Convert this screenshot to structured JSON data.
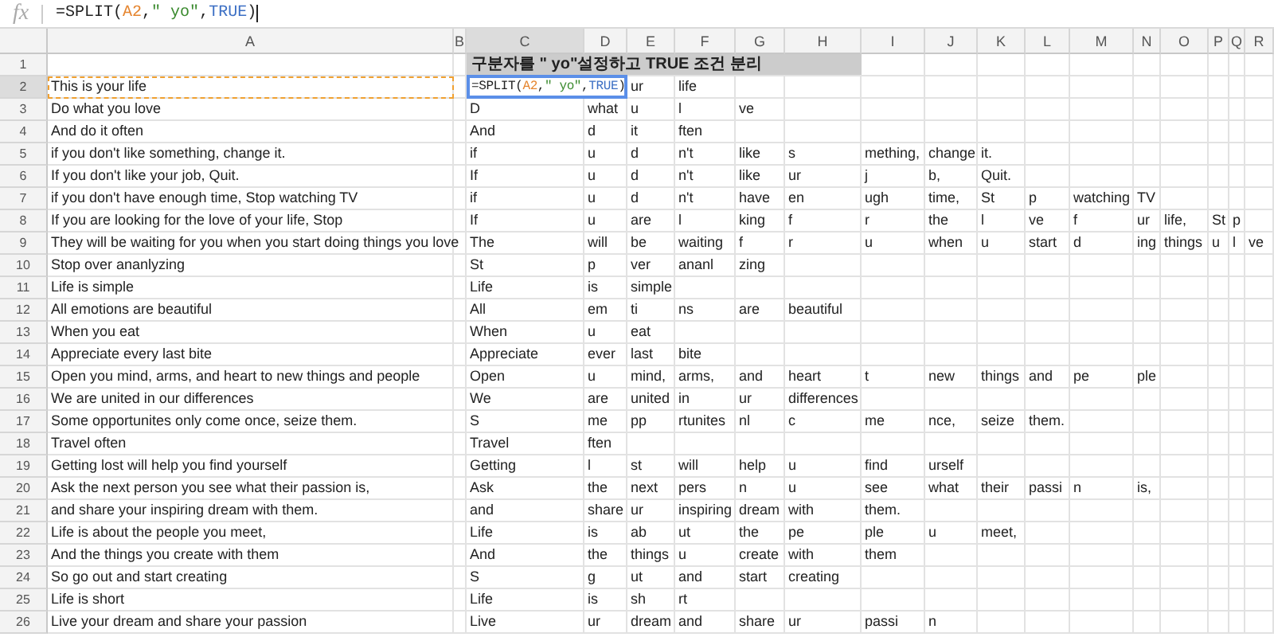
{
  "formula_bar": {
    "icon_text": "fx",
    "parts": [
      {
        "text": "=SPLIT(",
        "kind": "plain"
      },
      {
        "text": "A2",
        "kind": "ref"
      },
      {
        "text": ",",
        "kind": "plain"
      },
      {
        "text": "\" yo\"",
        "kind": "string"
      },
      {
        "text": ",",
        "kind": "plain"
      },
      {
        "text": "TRUE",
        "kind": "bool"
      },
      {
        "text": ")",
        "kind": "plain"
      }
    ]
  },
  "columns": [
    {
      "label": "A",
      "selected": false
    },
    {
      "label": "B",
      "selected": false
    },
    {
      "label": "C",
      "selected": true
    },
    {
      "label": "D",
      "selected": false
    },
    {
      "label": "E",
      "selected": false
    },
    {
      "label": "F",
      "selected": false
    },
    {
      "label": "G",
      "selected": false
    },
    {
      "label": "H",
      "selected": false
    },
    {
      "label": "I",
      "selected": false
    },
    {
      "label": "J",
      "selected": false
    },
    {
      "label": "K",
      "selected": false
    },
    {
      "label": "L",
      "selected": false
    },
    {
      "label": "M",
      "selected": false
    },
    {
      "label": "N",
      "selected": false
    },
    {
      "label": "O",
      "selected": false
    },
    {
      "label": "P",
      "selected": false
    },
    {
      "label": "Q",
      "selected": false
    },
    {
      "label": "R",
      "selected": false
    }
  ],
  "rows": [
    {
      "number": "1",
      "selected": false,
      "banner": "구분자를 \" yo\"설정하고 TRUE 조건 분리"
    },
    {
      "number": "2",
      "selected": true,
      "a": "This is your life",
      "copy_selected": true,
      "editor": [
        {
          "text": "=SPLIT(",
          "kind": "plain"
        },
        {
          "text": "A2",
          "kind": "ref"
        },
        {
          "text": ",",
          "kind": "plain"
        },
        {
          "text": "\" yo\"",
          "kind": "string"
        },
        {
          "text": ",",
          "kind": "plain"
        },
        {
          "text": "TRUE",
          "kind": "bool"
        },
        {
          "text": ")",
          "kind": "plain"
        }
      ],
      "split": [
        "ur",
        "life"
      ]
    },
    {
      "number": "3",
      "selected": false,
      "a": "Do what you love",
      "split": [
        "D",
        "what",
        "u",
        "l",
        "ve"
      ]
    },
    {
      "number": "4",
      "selected": false,
      "a": "And do it often",
      "split": [
        "And",
        "d",
        "it",
        "ften"
      ]
    },
    {
      "number": "5",
      "selected": false,
      "a": "if you don't like something, change it.",
      "split": [
        "if",
        "u",
        "d",
        "n't",
        "like",
        "s",
        "mething,",
        "change",
        "it."
      ]
    },
    {
      "number": "6",
      "selected": false,
      "a": "If you don't like your job, Quit.",
      "split": [
        "If",
        "u",
        "d",
        "n't",
        "like",
        "ur",
        "j",
        "b,",
        "Quit."
      ]
    },
    {
      "number": "7",
      "selected": false,
      "a": "if you don't have enough time, Stop watching TV",
      "split": [
        "if",
        "u",
        "d",
        "n't",
        "have",
        "en",
        "ugh",
        "time,",
        "St",
        "p",
        "watching",
        "TV"
      ]
    },
    {
      "number": "8",
      "selected": false,
      "a": "If you are looking for the love of your life, Stop",
      "split": [
        "If",
        "u",
        "are",
        "l",
        "king",
        "f",
        "r",
        "the",
        "l",
        "ve",
        "f",
        "ur",
        "life,",
        "St",
        "p"
      ]
    },
    {
      "number": "9",
      "selected": false,
      "a": "They will be waiting for you when you start doing things you love",
      "split": [
        "The",
        "will",
        "be",
        "waiting",
        "f",
        "r",
        "u",
        "when",
        "u",
        "start",
        "d",
        "ing",
        "things",
        "u",
        "l",
        "ve"
      ]
    },
    {
      "number": "10",
      "selected": false,
      "a": "Stop over ananlyzing",
      "split": [
        "St",
        "p",
        "ver",
        "ananl",
        "zing"
      ]
    },
    {
      "number": "11",
      "selected": false,
      "a": "Life is simple",
      "split": [
        "Life",
        "is",
        "simple"
      ]
    },
    {
      "number": "12",
      "selected": false,
      "a": "All emotions are beautiful",
      "split": [
        "All",
        "em",
        "ti",
        "ns",
        "are",
        "beautiful"
      ]
    },
    {
      "number": "13",
      "selected": false,
      "a": "When you eat",
      "split": [
        "When",
        "u",
        "eat"
      ]
    },
    {
      "number": "14",
      "selected": false,
      "a": "Appreciate every last bite",
      "split": [
        "Appreciate",
        "ever",
        "last",
        "bite"
      ]
    },
    {
      "number": "15",
      "selected": false,
      "a": "Open you mind, arms, and heart to new things and people",
      "split": [
        "Open",
        "u",
        "mind,",
        "arms,",
        "and",
        "heart",
        "t",
        "new",
        "things",
        "and",
        "pe",
        "ple"
      ]
    },
    {
      "number": "16",
      "selected": false,
      "a": "We are united in our differences",
      "split": [
        "We",
        "are",
        "united",
        "in",
        "ur",
        "differences"
      ]
    },
    {
      "number": "17",
      "selected": false,
      "a": "Some opportunites only come once, seize them.",
      "split": [
        "S",
        "me",
        "pp",
        "rtunites",
        "nl",
        "c",
        "me",
        "nce,",
        "seize",
        "them."
      ]
    },
    {
      "number": "18",
      "selected": false,
      "a": "Travel often",
      "split": [
        "Travel",
        "ften"
      ]
    },
    {
      "number": "19",
      "selected": false,
      "a": "Getting lost will help you find yourself",
      "split": [
        "Getting",
        "l",
        "st",
        "will",
        "help",
        "u",
        "find",
        "urself"
      ]
    },
    {
      "number": "20",
      "selected": false,
      "a": "Ask the next person you see what their passion is,",
      "split": [
        "Ask",
        "the",
        "next",
        "pers",
        "n",
        "u",
        "see",
        "what",
        "their",
        "passi",
        "n",
        "is,"
      ]
    },
    {
      "number": "21",
      "selected": false,
      "a": "and share your inspiring dream with them.",
      "split": [
        "and",
        "share",
        "ur",
        "inspiring",
        "dream",
        "with",
        "them."
      ]
    },
    {
      "number": "22",
      "selected": false,
      "a": "Life is about the people you meet,",
      "split": [
        "Life",
        "is",
        "ab",
        "ut",
        "the",
        "pe",
        "ple",
        "u",
        "meet,"
      ]
    },
    {
      "number": "23",
      "selected": false,
      "a": "And the things you create with them",
      "split": [
        "And",
        "the",
        "things",
        "u",
        "create",
        "with",
        "them"
      ]
    },
    {
      "number": "24",
      "selected": false,
      "a": "So go out and start creating",
      "split": [
        "S",
        "g",
        "ut",
        "and",
        "start",
        "creating"
      ]
    },
    {
      "number": "25",
      "selected": false,
      "a": "Life is short",
      "split": [
        "Life",
        "is",
        "sh",
        "rt"
      ]
    },
    {
      "number": "26",
      "selected": false,
      "a": "Live your dream and share your passion",
      "split": [
        "Live",
        "ur",
        "dream",
        "and",
        "share",
        "ur",
        "passi",
        "n"
      ]
    }
  ]
}
